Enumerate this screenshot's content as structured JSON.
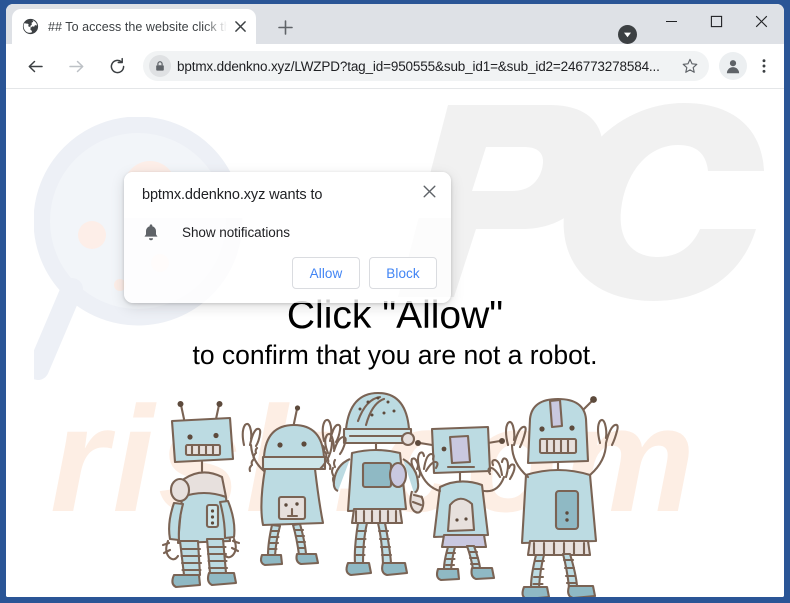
{
  "browser": {
    "tab": {
      "title": "## To access the website click th",
      "favicon_icon": "globe-icon",
      "close_icon": "close-icon"
    },
    "new_tab_label": "+",
    "download_indicator_icon": "download-arrow-icon",
    "window_controls": {
      "minimize_icon": "minimize-icon",
      "maximize_icon": "maximize-icon",
      "close_icon": "close-icon"
    },
    "toolbar": {
      "back_icon": "back-arrow-icon",
      "forward_icon": "forward-arrow-icon",
      "reload_icon": "reload-icon",
      "lock_icon": "lock-icon",
      "url": "bptmx.ddenkno.xyz/LWZPD?tag_id=950555&sub_id1=&sub_id2=246773278584...",
      "bookmark_icon": "star-icon",
      "profile_icon": "avatar-icon",
      "menu_icon": "three-dot-menu-icon"
    }
  },
  "permission_dialog": {
    "title": "bptmx.ddenkno.xyz wants to",
    "close_icon": "close-icon",
    "permission_icon": "bell-icon",
    "permission_label": "Show notifications",
    "allow_label": "Allow",
    "block_label": "Block"
  },
  "page": {
    "headline_line1": "Click \"Allow\"",
    "headline_line2": "to confirm that you are not a robot.",
    "illustration": "robots-illustration",
    "watermark": {
      "magnifier": "magnifying-glass-watermark",
      "logo": "pc-logo-watermark",
      "text": "risk.com"
    }
  },
  "colors": {
    "frame": "#2a5596",
    "tabstrip": "#dee1e6",
    "omnibox": "#f1f3f4",
    "link_blue": "#4285f4",
    "robot_body": "#b9d9e0",
    "robot_outline": "#6b584a",
    "watermark_grey": "#f0f0f0",
    "watermark_orange": "#fdeee4"
  }
}
